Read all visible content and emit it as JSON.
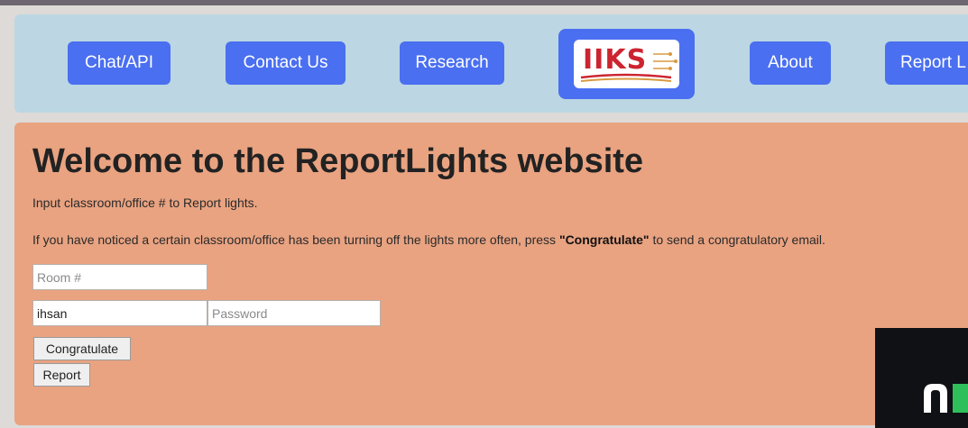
{
  "nav": {
    "items": [
      "Chat/API",
      "Contact Us",
      "Research",
      "About",
      "Report L"
    ],
    "logo_text": "IIKS"
  },
  "main": {
    "title": "Welcome to the ReportLights website",
    "instruction": "Input classroom/office # to Report lights.",
    "congrats_text_before": "If you have noticed a certain classroom/office has been turning off the lights more often, press ",
    "congrats_text_bold": "\"Congratulate\"",
    "congrats_text_after": " to send a congratulatory email."
  },
  "form": {
    "room_placeholder": "Room #",
    "username_value": "ihsan",
    "password_placeholder": "Password",
    "congratulate_label": "Congratulate",
    "report_label": "Report"
  },
  "colors": {
    "navbar_bg": "#bcd7e3",
    "button_blue": "#4a6ff0",
    "main_bg": "#e9a381",
    "logo_red": "#cc2430"
  },
  "icons": {
    "overlay_logo": "n-logo-icon"
  }
}
